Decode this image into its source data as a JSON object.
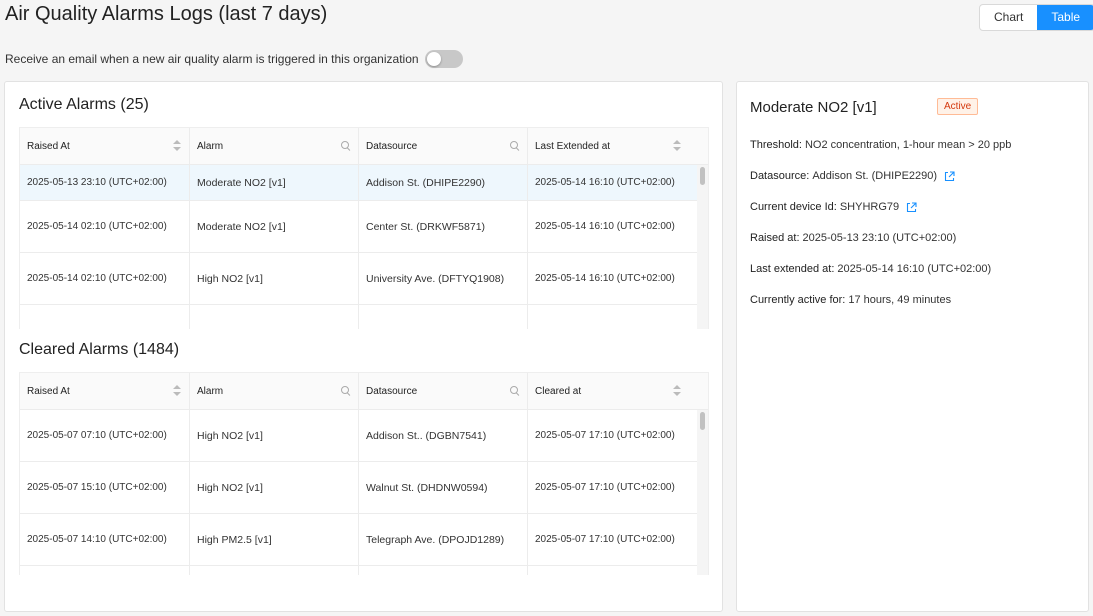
{
  "page": {
    "title": "Air Quality Alarms Logs (last 7 days)",
    "view_toggle": {
      "chart_label": "Chart",
      "table_label": "Table",
      "selected": "Table"
    },
    "email_toggle": {
      "label": "Receive an email when a new air quality alarm is triggered in this organization",
      "enabled": false
    }
  },
  "active_alarms": {
    "title": "Active Alarms (25)",
    "columns": [
      "Raised At",
      "Alarm",
      "Datasource",
      "Last Extended at"
    ],
    "rows": [
      {
        "raised_at": "2025-05-13 23:10 (UTC+02:00)",
        "alarm": "Moderate NO2 [v1]",
        "datasource": "Addison St. (DHIPE2290)",
        "last_extended": "2025-05-14 16:10 (UTC+02:00)"
      },
      {
        "raised_at": "2025-05-14 02:10 (UTC+02:00)",
        "alarm": "Moderate NO2 [v1]",
        "datasource": "Center St. (DRKWF5871)",
        "last_extended": "2025-05-14 16:10 (UTC+02:00)"
      },
      {
        "raised_at": "2025-05-14 02:10 (UTC+02:00)",
        "alarm": "High NO2 [v1]",
        "datasource": "University Ave. (DFTYQ1908)",
        "last_extended": "2025-05-14 16:10 (UTC+02:00)"
      }
    ]
  },
  "cleared_alarms": {
    "title": "Cleared Alarms (1484)",
    "columns": [
      "Raised At",
      "Alarm",
      "Datasource",
      "Cleared at"
    ],
    "rows": [
      {
        "raised_at": "2025-05-07 07:10 (UTC+02:00)",
        "alarm": "High NO2 [v1]",
        "datasource": "Addison St.. (DGBN7541)",
        "cleared_at": "2025-05-07 17:10 (UTC+02:00)"
      },
      {
        "raised_at": "2025-05-07 15:10 (UTC+02:00)",
        "alarm": "High NO2 [v1]",
        "datasource": "Walnut St. (DHDNW0594)",
        "cleared_at": "2025-05-07 17:10 (UTC+02:00)"
      },
      {
        "raised_at": "2025-05-07 14:10 (UTC+02:00)",
        "alarm": "High PM2.5 [v1]",
        "datasource": "Telegraph Ave. (DPOJD1289)",
        "cleared_at": "2025-05-07 17:10 (UTC+02:00)"
      }
    ]
  },
  "detail": {
    "title": "Moderate NO2 [v1]",
    "status": "Active",
    "threshold_label": "Threshold:",
    "threshold_value": "NO2 concentration, 1-hour mean > 20 ppb",
    "datasource_label": "Datasource:",
    "datasource_value": "Addison St. (DHIPE2290)",
    "device_label": "Current device Id:",
    "device_value": "SHYHRG79",
    "raised_label": "Raised at:",
    "raised_value": "2025-05-13 23:10 (UTC+02:00)",
    "extended_label": "Last extended at:",
    "extended_value": "2025-05-14 16:10 (UTC+02:00)",
    "active_for_label": "Currently active for:",
    "active_for_value": "17 hours, 49 minutes"
  },
  "colors": {
    "accent": "#1890ff",
    "active_badge": "#d4380d",
    "row_highlight": "#eef7fd"
  },
  "icons": [
    "sort-icon",
    "search-icon",
    "external-link-icon"
  ]
}
